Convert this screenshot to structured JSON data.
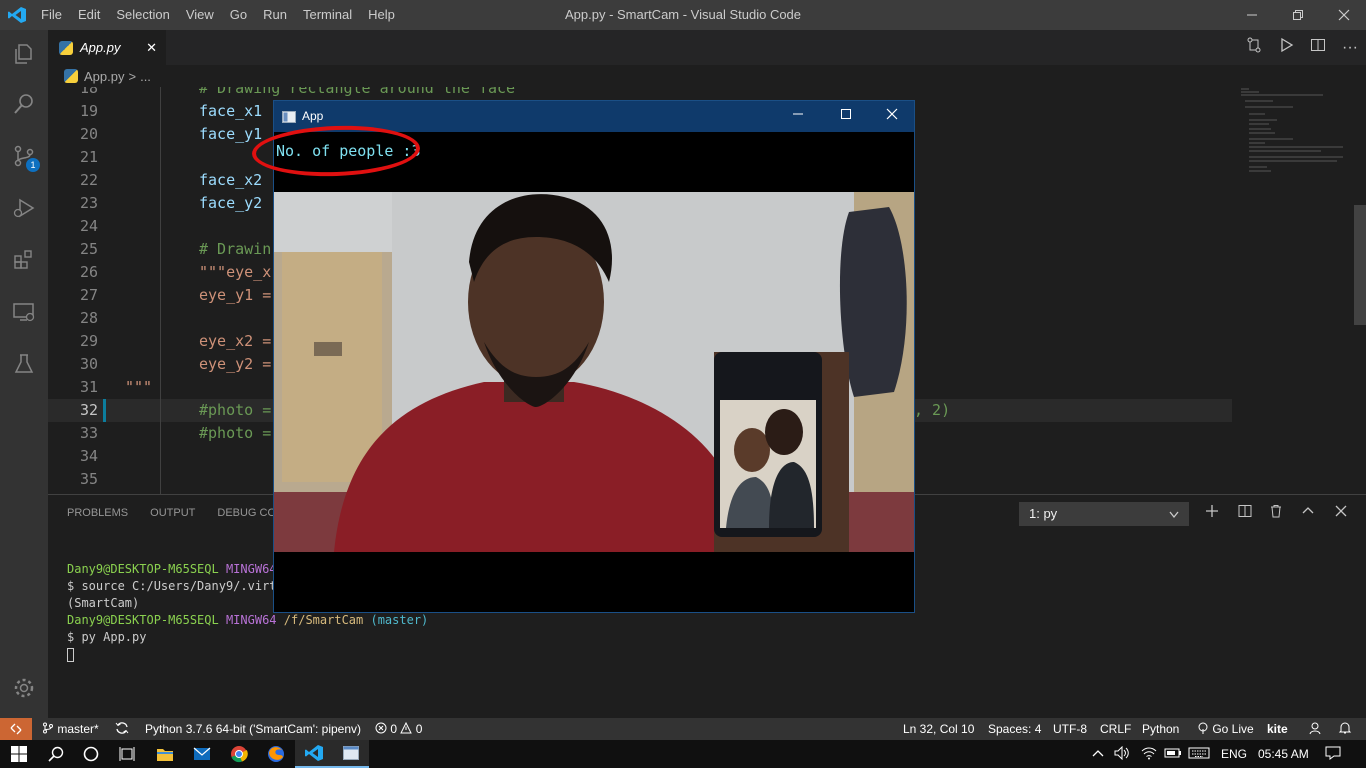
{
  "window": {
    "title": "App.py - SmartCam - Visual Studio Code"
  },
  "menu": [
    "File",
    "Edit",
    "Selection",
    "View",
    "Go",
    "Run",
    "Terminal",
    "Help"
  ],
  "activity_badge": "1",
  "tab": {
    "label": "App.py"
  },
  "breadcrumb": {
    "file": "App.py",
    "sep": ">",
    "more": "..."
  },
  "code_lines": [
    {
      "n": "18",
      "t": "# Drawing rectangle around the face"
    },
    {
      "n": "19",
      "t": "face_x1"
    },
    {
      "n": "20",
      "t": "face_y1"
    },
    {
      "n": "21",
      "t": ""
    },
    {
      "n": "22",
      "t": "face_x2"
    },
    {
      "n": "23",
      "t": "face_y2"
    },
    {
      "n": "24",
      "t": ""
    },
    {
      "n": "25",
      "t": "# Drawin"
    },
    {
      "n": "26",
      "t": "\"\"\"eye_x"
    },
    {
      "n": "27",
      "t": "eye_y1 ="
    },
    {
      "n": "28",
      "t": ""
    },
    {
      "n": "29",
      "t": "eye_x2 ="
    },
    {
      "n": "30",
      "t": "eye_y2 ="
    },
    {
      "n": "31",
      "t": "\"\"\""
    },
    {
      "n": "32",
      "t": "#photo ="
    },
    {
      "n": "33",
      "t": "#photo ="
    },
    {
      "n": "34",
      "t": ""
    },
    {
      "n": "35",
      "t": ""
    }
  ],
  "code_tail_32": ", 2)",
  "panel": {
    "tabs": [
      "PROBLEMS",
      "OUTPUT",
      "DEBUG CONSO"
    ],
    "terminal_select": "1: py"
  },
  "terminal": {
    "l1_user": "Dany9@DESKTOP-M65SEQL",
    "l1_env": "MINGW64",
    "l2": "$ source C:/Users/Dany9/.virtu",
    "l3": "(SmartCam)",
    "l4_user": "Dany9@DESKTOP-M65SEQL",
    "l4_env": "MINGW64",
    "l4_path": "/f/SmartCam",
    "l4_branch": "(master)",
    "l5": "$ py App.py"
  },
  "statusbar": {
    "branch": "master*",
    "python": "Python 3.7.6 64-bit ('SmartCam': pipenv)",
    "errors": "0",
    "warnings": "0",
    "position": "Ln 32, Col 10",
    "spaces": "Spaces: 4",
    "encoding": "UTF-8",
    "eol": "CRLF",
    "language": "Python",
    "golive": "Go Live",
    "kite": "kite"
  },
  "taskbar": {
    "lang": "ENG",
    "time": "05:45 AM"
  },
  "app_window": {
    "title": "App",
    "count_text": "No. of people :3"
  }
}
